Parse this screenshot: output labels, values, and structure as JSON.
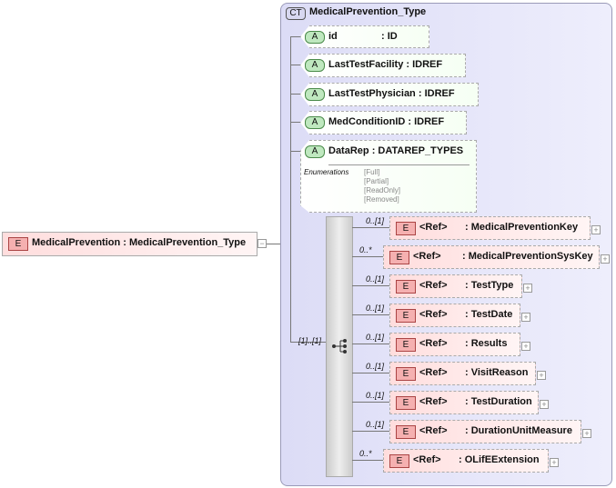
{
  "root": {
    "badge": "E",
    "label": "MedicalPrevention : MedicalPrevention_Type"
  },
  "complex_type": {
    "badge": "CT",
    "title": "MedicalPrevention_Type"
  },
  "attributes": [
    {
      "badge": "A",
      "name": "id",
      "type": ": ID"
    },
    {
      "badge": "A",
      "name": "LastTestFacility",
      "type": ": IDREF"
    },
    {
      "badge": "A",
      "name": "LastTestPhysician",
      "type": ": IDREF"
    },
    {
      "badge": "A",
      "name": "MedConditionID",
      "type": ": IDREF"
    },
    {
      "badge": "A",
      "name": "DataRep",
      "type": ": DATAREP_TYPES",
      "enumerations_label": "Enumerations",
      "enumerations": [
        "[Full]",
        "[Partial]",
        "[ReadOnly]",
        "[Removed]"
      ]
    }
  ],
  "sequence": {
    "cardinality": "[1]..[1]"
  },
  "children": [
    {
      "card": "0..[1]",
      "badge": "E",
      "ref": "<Ref>",
      "name": ": MedicalPreventionKey"
    },
    {
      "card": "0..*",
      "badge": "E",
      "ref": "<Ref>",
      "name": ": MedicalPreventionSysKey"
    },
    {
      "card": "0..[1]",
      "badge": "E",
      "ref": "<Ref>",
      "name": ": TestType"
    },
    {
      "card": "0..[1]",
      "badge": "E",
      "ref": "<Ref>",
      "name": ": TestDate"
    },
    {
      "card": "0..[1]",
      "badge": "E",
      "ref": "<Ref>",
      "name": ": Results"
    },
    {
      "card": "0..[1]",
      "badge": "E",
      "ref": "<Ref>",
      "name": ": VisitReason"
    },
    {
      "card": "0..[1]",
      "badge": "E",
      "ref": "<Ref>",
      "name": ": TestDuration"
    },
    {
      "card": "0..[1]",
      "badge": "E",
      "ref": "<Ref>",
      "name": ": DurationUnitMeasure"
    },
    {
      "card": "0..*",
      "badge": "E",
      "ref": "<Ref>",
      "name": ": OLifEExtension"
    }
  ],
  "expand_symbol": "+",
  "collapse_symbol": "−"
}
